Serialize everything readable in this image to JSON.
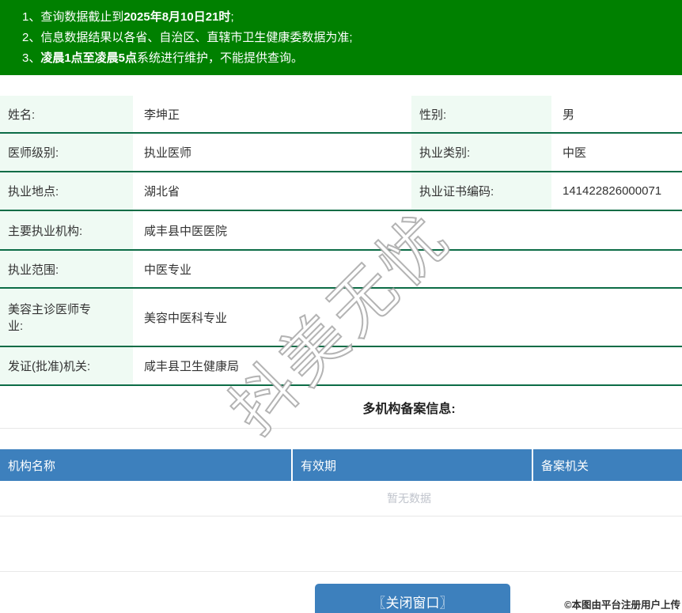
{
  "banner": {
    "bg_color": "#008000",
    "lines": [
      {
        "prefix": "1、查询数据截止到",
        "bold": "2025年8月10日21时",
        "suffix": ";"
      },
      {
        "prefix": "2、信息数据结果以各省、自治区、直辖市卫生健康委数据为准;",
        "bold": "",
        "suffix": ""
      },
      {
        "prefix": "3、",
        "bold": "凌晨1点至凌晨5点",
        "suffix": "系统进行维护，不能提供查询。"
      }
    ]
  },
  "info": {
    "label_bg": "#effaf3",
    "divider_color": "#0c6c46",
    "rows": [
      {
        "label": "姓名:",
        "value": "李坤正",
        "label2": "性别:",
        "value2": "男"
      },
      {
        "label": "医师级别:",
        "value": "执业医师",
        "label2": "执业类别:",
        "value2": "中医"
      },
      {
        "label": "执业地点:",
        "value": "湖北省",
        "label2": "执业证书编码:",
        "value2": "141422826000071"
      },
      {
        "label": "主要执业机构:",
        "value": "咸丰县中医医院"
      },
      {
        "label": "执业范围:",
        "value": "中医专业"
      },
      {
        "label": "美容主诊医师专业:",
        "value": "美容中医科专业"
      },
      {
        "label": "发证(批准)机关:",
        "value": "咸丰县卫生健康局"
      }
    ]
  },
  "records": {
    "title": "多机构备案信息:",
    "header_bg": "#3d80bd",
    "columns": [
      "机构名称",
      "有效期",
      "备案机关"
    ],
    "empty_text": "暂无数据"
  },
  "footer": {
    "close_button_label": "〖关闭窗口〗",
    "button_color": "#3d80bd"
  },
  "watermark": {
    "text": "抖美无忧"
  },
  "credit": "©本图由平台注册用户上传"
}
